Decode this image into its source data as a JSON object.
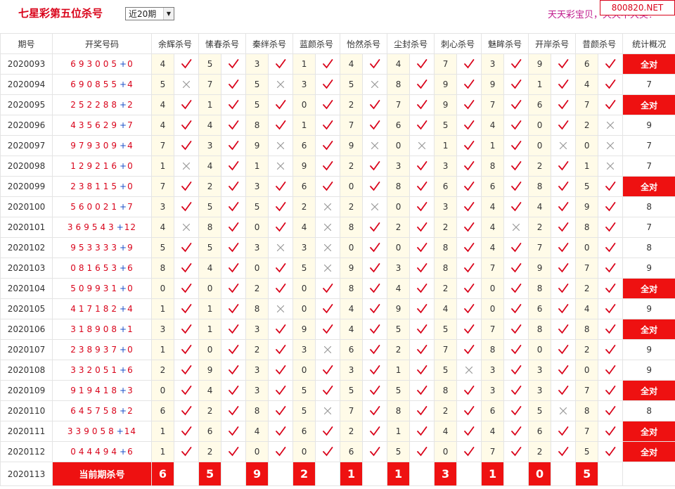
{
  "page": {
    "title": "七星彩第五位杀号",
    "period_select": "近20期",
    "slogan": "天天彩宝贝，天天中大奖！",
    "site_badge": "800820.NET"
  },
  "colors": {
    "accent": "#d9041b",
    "hit_bg": "#fffbe8",
    "all_right": "#ee1111",
    "bonus_blue": "#1b4fc9",
    "check": "#d9041b",
    "cross": "#999999"
  },
  "headers": [
    "期号",
    "开奖号码",
    "余辉杀号",
    "愫春杀号",
    "秦绊杀号",
    "蓝颜杀号",
    "怡然杀号",
    "尘封杀号",
    "刺心杀号",
    "魅眸杀号",
    "开岸杀号",
    "昔颜杀号",
    "统计概况"
  ],
  "rows": [
    {
      "issue": "2020093",
      "draw": "693005",
      "bonus": "0",
      "kills": [
        [
          "4",
          "v"
        ],
        [
          "5",
          "v"
        ],
        [
          "3",
          "v"
        ],
        [
          "1",
          "v"
        ],
        [
          "4",
          "v"
        ],
        [
          "4",
          "v"
        ],
        [
          "7",
          "v"
        ],
        [
          "3",
          "v"
        ],
        [
          "9",
          "v"
        ],
        [
          "6",
          "v"
        ]
      ],
      "summary": "全对"
    },
    {
      "issue": "2020094",
      "draw": "690855",
      "bonus": "4",
      "kills": [
        [
          "5",
          "x"
        ],
        [
          "7",
          "v"
        ],
        [
          "5",
          "x"
        ],
        [
          "3",
          "v"
        ],
        [
          "5",
          "x"
        ],
        [
          "8",
          "v"
        ],
        [
          "9",
          "v"
        ],
        [
          "9",
          "v"
        ],
        [
          "1",
          "v"
        ],
        [
          "4",
          "v"
        ]
      ],
      "summary": "7"
    },
    {
      "issue": "2020095",
      "draw": "252288",
      "bonus": "2",
      "kills": [
        [
          "4",
          "v"
        ],
        [
          "1",
          "v"
        ],
        [
          "5",
          "v"
        ],
        [
          "0",
          "v"
        ],
        [
          "2",
          "v"
        ],
        [
          "7",
          "v"
        ],
        [
          "9",
          "v"
        ],
        [
          "7",
          "v"
        ],
        [
          "6",
          "v"
        ],
        [
          "7",
          "v"
        ]
      ],
      "summary": "全对"
    },
    {
      "issue": "2020096",
      "draw": "435629",
      "bonus": "7",
      "kills": [
        [
          "4",
          "v"
        ],
        [
          "4",
          "v"
        ],
        [
          "8",
          "v"
        ],
        [
          "1",
          "v"
        ],
        [
          "7",
          "v"
        ],
        [
          "6",
          "v"
        ],
        [
          "5",
          "v"
        ],
        [
          "4",
          "v"
        ],
        [
          "0",
          "v"
        ],
        [
          "2",
          "x"
        ]
      ],
      "summary": "9"
    },
    {
      "issue": "2020097",
      "draw": "979309",
      "bonus": "4",
      "kills": [
        [
          "7",
          "v"
        ],
        [
          "3",
          "v"
        ],
        [
          "9",
          "x"
        ],
        [
          "6",
          "v"
        ],
        [
          "9",
          "x"
        ],
        [
          "0",
          "x"
        ],
        [
          "1",
          "v"
        ],
        [
          "1",
          "v"
        ],
        [
          "0",
          "x"
        ],
        [
          "0",
          "x"
        ]
      ],
      "summary": "7"
    },
    {
      "issue": "2020098",
      "draw": "129216",
      "bonus": "0",
      "kills": [
        [
          "1",
          "x"
        ],
        [
          "4",
          "v"
        ],
        [
          "1",
          "x"
        ],
        [
          "9",
          "v"
        ],
        [
          "2",
          "v"
        ],
        [
          "3",
          "v"
        ],
        [
          "3",
          "v"
        ],
        [
          "8",
          "v"
        ],
        [
          "2",
          "v"
        ],
        [
          "1",
          "x"
        ]
      ],
      "summary": "7"
    },
    {
      "issue": "2020099",
      "draw": "238115",
      "bonus": "0",
      "kills": [
        [
          "7",
          "v"
        ],
        [
          "2",
          "v"
        ],
        [
          "3",
          "v"
        ],
        [
          "6",
          "v"
        ],
        [
          "0",
          "v"
        ],
        [
          "8",
          "v"
        ],
        [
          "6",
          "v"
        ],
        [
          "6",
          "v"
        ],
        [
          "8",
          "v"
        ],
        [
          "5",
          "v"
        ]
      ],
      "summary": "全对"
    },
    {
      "issue": "2020100",
      "draw": "560021",
      "bonus": "7",
      "kills": [
        [
          "3",
          "v"
        ],
        [
          "5",
          "v"
        ],
        [
          "5",
          "v"
        ],
        [
          "2",
          "x"
        ],
        [
          "2",
          "x"
        ],
        [
          "0",
          "v"
        ],
        [
          "3",
          "v"
        ],
        [
          "4",
          "v"
        ],
        [
          "4",
          "v"
        ],
        [
          "9",
          "v"
        ]
      ],
      "summary": "8"
    },
    {
      "issue": "2020101",
      "draw": "369543",
      "bonus": "12",
      "kills": [
        [
          "4",
          "x"
        ],
        [
          "8",
          "v"
        ],
        [
          "0",
          "v"
        ],
        [
          "4",
          "x"
        ],
        [
          "8",
          "v"
        ],
        [
          "2",
          "v"
        ],
        [
          "2",
          "v"
        ],
        [
          "4",
          "x"
        ],
        [
          "2",
          "v"
        ],
        [
          "8",
          "v"
        ]
      ],
      "summary": "7"
    },
    {
      "issue": "2020102",
      "draw": "953333",
      "bonus": "9",
      "kills": [
        [
          "5",
          "v"
        ],
        [
          "5",
          "v"
        ],
        [
          "3",
          "x"
        ],
        [
          "3",
          "x"
        ],
        [
          "0",
          "v"
        ],
        [
          "0",
          "v"
        ],
        [
          "8",
          "v"
        ],
        [
          "4",
          "v"
        ],
        [
          "7",
          "v"
        ],
        [
          "0",
          "v"
        ]
      ],
      "summary": "8"
    },
    {
      "issue": "2020103",
      "draw": "081653",
      "bonus": "6",
      "kills": [
        [
          "8",
          "v"
        ],
        [
          "4",
          "v"
        ],
        [
          "0",
          "v"
        ],
        [
          "5",
          "x"
        ],
        [
          "9",
          "v"
        ],
        [
          "3",
          "v"
        ],
        [
          "8",
          "v"
        ],
        [
          "7",
          "v"
        ],
        [
          "9",
          "v"
        ],
        [
          "7",
          "v"
        ]
      ],
      "summary": "9"
    },
    {
      "issue": "2020104",
      "draw": "509931",
      "bonus": "0",
      "kills": [
        [
          "0",
          "v"
        ],
        [
          "0",
          "v"
        ],
        [
          "2",
          "v"
        ],
        [
          "0",
          "v"
        ],
        [
          "8",
          "v"
        ],
        [
          "4",
          "v"
        ],
        [
          "2",
          "v"
        ],
        [
          "0",
          "v"
        ],
        [
          "8",
          "v"
        ],
        [
          "2",
          "v"
        ]
      ],
      "summary": "全对"
    },
    {
      "issue": "2020105",
      "draw": "417182",
      "bonus": "4",
      "kills": [
        [
          "1",
          "v"
        ],
        [
          "1",
          "v"
        ],
        [
          "8",
          "x"
        ],
        [
          "0",
          "v"
        ],
        [
          "4",
          "v"
        ],
        [
          "9",
          "v"
        ],
        [
          "4",
          "v"
        ],
        [
          "0",
          "v"
        ],
        [
          "6",
          "v"
        ],
        [
          "4",
          "v"
        ]
      ],
      "summary": "9"
    },
    {
      "issue": "2020106",
      "draw": "318908",
      "bonus": "1",
      "kills": [
        [
          "3",
          "v"
        ],
        [
          "1",
          "v"
        ],
        [
          "3",
          "v"
        ],
        [
          "9",
          "v"
        ],
        [
          "4",
          "v"
        ],
        [
          "5",
          "v"
        ],
        [
          "5",
          "v"
        ],
        [
          "7",
          "v"
        ],
        [
          "8",
          "v"
        ],
        [
          "8",
          "v"
        ]
      ],
      "summary": "全对"
    },
    {
      "issue": "2020107",
      "draw": "238937",
      "bonus": "0",
      "kills": [
        [
          "1",
          "v"
        ],
        [
          "0",
          "v"
        ],
        [
          "2",
          "v"
        ],
        [
          "3",
          "x"
        ],
        [
          "6",
          "v"
        ],
        [
          "2",
          "v"
        ],
        [
          "7",
          "v"
        ],
        [
          "8",
          "v"
        ],
        [
          "0",
          "v"
        ],
        [
          "2",
          "v"
        ]
      ],
      "summary": "9"
    },
    {
      "issue": "2020108",
      "draw": "332051",
      "bonus": "6",
      "kills": [
        [
          "2",
          "v"
        ],
        [
          "9",
          "v"
        ],
        [
          "3",
          "v"
        ],
        [
          "0",
          "v"
        ],
        [
          "3",
          "v"
        ],
        [
          "1",
          "v"
        ],
        [
          "5",
          "x"
        ],
        [
          "3",
          "v"
        ],
        [
          "3",
          "v"
        ],
        [
          "0",
          "v"
        ]
      ],
      "summary": "9"
    },
    {
      "issue": "2020109",
      "draw": "919418",
      "bonus": "3",
      "kills": [
        [
          "0",
          "v"
        ],
        [
          "4",
          "v"
        ],
        [
          "3",
          "v"
        ],
        [
          "5",
          "v"
        ],
        [
          "5",
          "v"
        ],
        [
          "5",
          "v"
        ],
        [
          "8",
          "v"
        ],
        [
          "3",
          "v"
        ],
        [
          "3",
          "v"
        ],
        [
          "7",
          "v"
        ]
      ],
      "summary": "全对"
    },
    {
      "issue": "2020110",
      "draw": "645758",
      "bonus": "2",
      "kills": [
        [
          "6",
          "v"
        ],
        [
          "2",
          "v"
        ],
        [
          "8",
          "v"
        ],
        [
          "5",
          "x"
        ],
        [
          "7",
          "v"
        ],
        [
          "8",
          "v"
        ],
        [
          "2",
          "v"
        ],
        [
          "6",
          "v"
        ],
        [
          "5",
          "x"
        ],
        [
          "8",
          "v"
        ]
      ],
      "summary": "8"
    },
    {
      "issue": "2020111",
      "draw": "339058",
      "bonus": "14",
      "kills": [
        [
          "1",
          "v"
        ],
        [
          "6",
          "v"
        ],
        [
          "4",
          "v"
        ],
        [
          "6",
          "v"
        ],
        [
          "2",
          "v"
        ],
        [
          "1",
          "v"
        ],
        [
          "4",
          "v"
        ],
        [
          "4",
          "v"
        ],
        [
          "6",
          "v"
        ],
        [
          "7",
          "v"
        ]
      ],
      "summary": "全对"
    },
    {
      "issue": "2020112",
      "draw": "044494",
      "bonus": "6",
      "kills": [
        [
          "1",
          "v"
        ],
        [
          "2",
          "v"
        ],
        [
          "0",
          "v"
        ],
        [
          "0",
          "v"
        ],
        [
          "6",
          "v"
        ],
        [
          "5",
          "v"
        ],
        [
          "0",
          "v"
        ],
        [
          "7",
          "v"
        ],
        [
          "2",
          "v"
        ],
        [
          "5",
          "v"
        ]
      ],
      "summary": "全对"
    }
  ],
  "current": {
    "issue": "2020113",
    "label": "当前期杀号",
    "kills": [
      "6",
      "5",
      "9",
      "2",
      "1",
      "1",
      "3",
      "1",
      "0",
      "5"
    ]
  }
}
